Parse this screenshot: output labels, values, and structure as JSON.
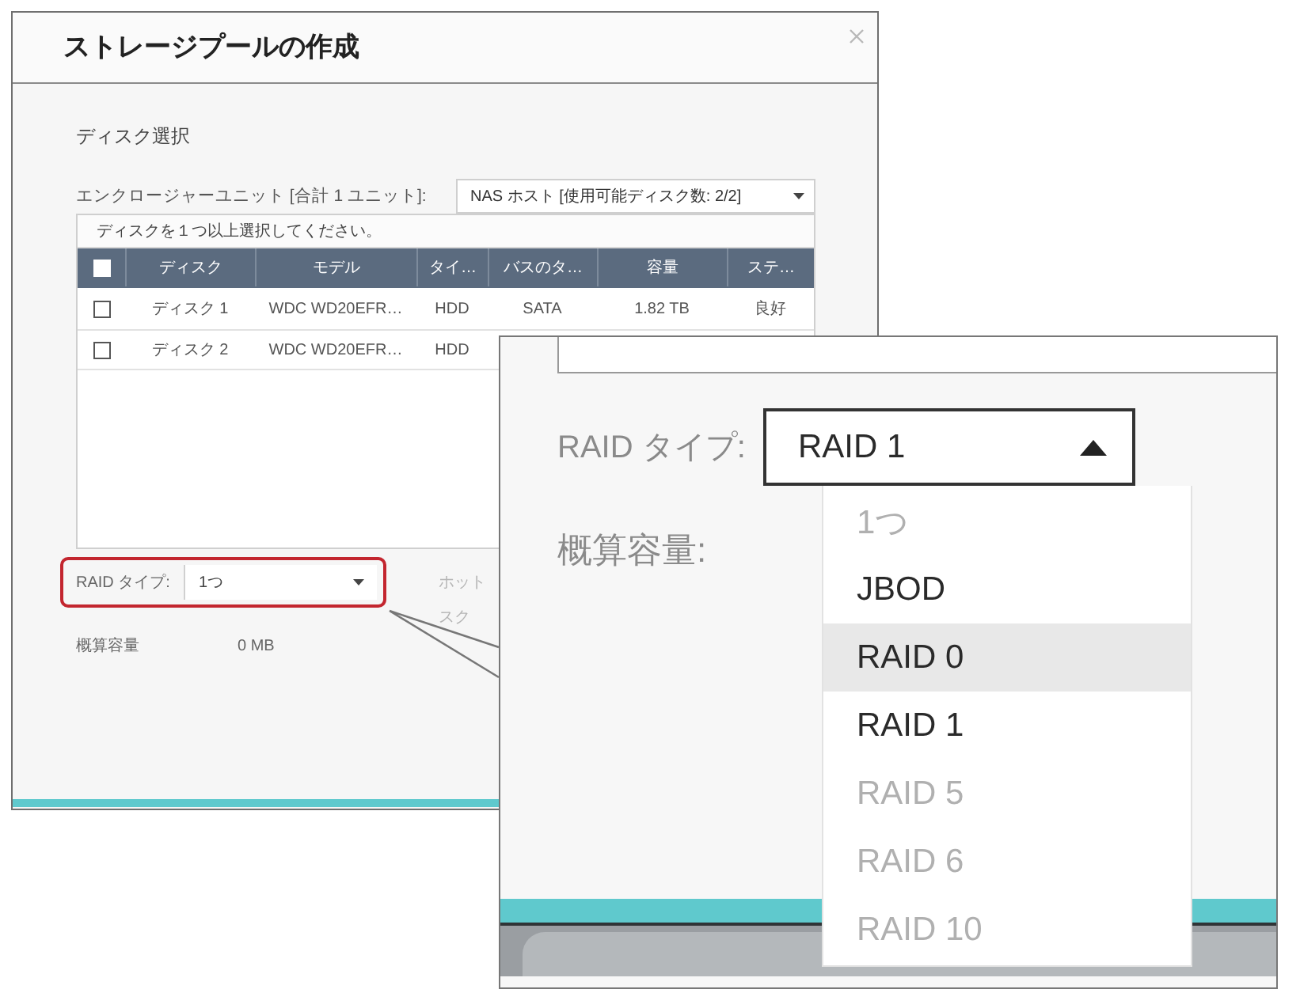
{
  "dialog": {
    "title": "ストレージプールの作成",
    "section_title": "ディスク選択",
    "enclosure": {
      "label": "エンクロージャーユニット [合計 1 ユニット]:",
      "value": "NAS ホスト [使用可能ディスク数: 2/2]"
    },
    "table": {
      "hint": "ディスクを１つ以上選択してください。",
      "select_all_checked": false,
      "columns": [
        "ディスク",
        "モデル",
        "タイ…",
        "バスのタ…",
        "容量",
        "ステ…"
      ],
      "rows": [
        {
          "checked": false,
          "cells": [
            "ディスク 1",
            "WDC WD20EFR…",
            "HDD",
            "SATA",
            "1.82 TB",
            "良好"
          ]
        },
        {
          "checked": false,
          "cells": [
            "ディスク 2",
            "WDC WD20EFR…",
            "HDD"
          ]
        }
      ]
    },
    "raid_type": {
      "label": "RAID タイプ:",
      "value": "1つ",
      "highlighted": true
    },
    "hot_spare": {
      "lines": [
        "ホット",
        "スク"
      ],
      "disabled": true
    },
    "capacity": {
      "label": "概算容量",
      "value": "0 MB"
    }
  },
  "zoom_panel": {
    "raid_type": {
      "label": "RAID タイプ:",
      "value": "RAID 1",
      "expanded": true,
      "options": [
        {
          "label": "1つ",
          "disabled": true,
          "highlighted": false
        },
        {
          "label": "JBOD",
          "disabled": false,
          "highlighted": false
        },
        {
          "label": "RAID 0",
          "disabled": false,
          "highlighted": true
        },
        {
          "label": "RAID 1",
          "disabled": false,
          "highlighted": false
        },
        {
          "label": "RAID 5",
          "disabled": true,
          "highlighted": false
        },
        {
          "label": "RAID 6",
          "disabled": true,
          "highlighted": false
        },
        {
          "label": "RAID 10",
          "disabled": true,
          "highlighted": false
        }
      ]
    },
    "capacity_label": "概算容量:"
  }
}
